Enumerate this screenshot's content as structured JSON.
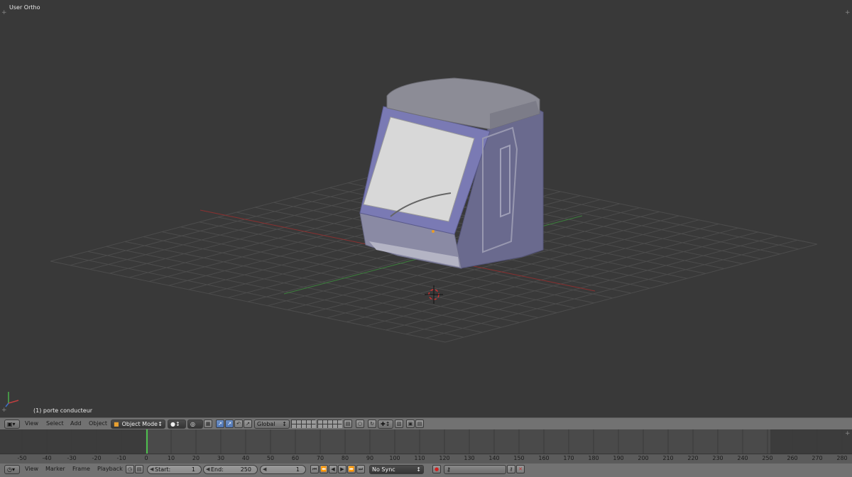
{
  "viewport": {
    "view_name": "User Ortho",
    "active_object": "(1) porte conducteur"
  },
  "viewport_header": {
    "menus": [
      "View",
      "Select",
      "Add",
      "Object"
    ],
    "mode": "Object Mode",
    "orientation": "Global"
  },
  "timeline": {
    "ruler_labels": [
      "-50",
      "-40",
      "-30",
      "-20",
      "-10",
      "0",
      "10",
      "20",
      "30",
      "40",
      "50",
      "60",
      "70",
      "80",
      "90",
      "100",
      "110",
      "120",
      "130",
      "140",
      "150",
      "160",
      "170",
      "180",
      "190",
      "200",
      "210",
      "220",
      "230",
      "240",
      "250",
      "260",
      "270",
      "280"
    ],
    "current_frame_marker": "0",
    "menus": [
      "View",
      "Marker",
      "Frame",
      "Playback"
    ],
    "start_label": "Start:",
    "start_value": "1",
    "end_label": "End:",
    "end_value": "250",
    "current_frame": "1",
    "sync_mode": "No Sync"
  },
  "colors": {
    "viewport_bg": "#393939",
    "header_bg": "#727272",
    "active_blue": "#5680c2",
    "frame_marker": "#4ec04e"
  }
}
